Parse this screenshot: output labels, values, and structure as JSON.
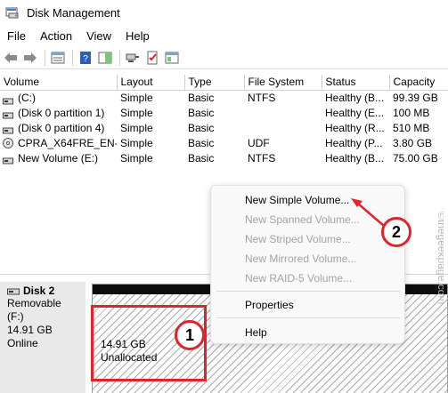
{
  "window": {
    "title": "Disk Management"
  },
  "menu": [
    "File",
    "Action",
    "View",
    "Help"
  ],
  "toolbar": {
    "buttons": [
      "back-arrow-icon",
      "forward-arrow-icon",
      "list-view-icon",
      "help-book-icon",
      "detail-pane-icon",
      "connect-icon",
      "checklist-icon",
      "properties-icon"
    ]
  },
  "table": {
    "headers": [
      "Volume",
      "Layout",
      "Type",
      "File System",
      "Status",
      "Capacity"
    ],
    "rows": [
      {
        "volume": "(C:)",
        "layout": "Simple",
        "type": "Basic",
        "fs": "NTFS",
        "status": "Healthy (B...",
        "capacity": "99.39 GB"
      },
      {
        "volume": "(Disk 0 partition 1)",
        "layout": "Simple",
        "type": "Basic",
        "fs": "",
        "status": "Healthy (E...",
        "capacity": "100 MB"
      },
      {
        "volume": "(Disk 0 partition 4)",
        "layout": "Simple",
        "type": "Basic",
        "fs": "",
        "status": "Healthy (R...",
        "capacity": "510 MB"
      },
      {
        "volume": "CPRA_X64FRE_EN-...",
        "layout": "Simple",
        "type": "Basic",
        "fs": "UDF",
        "status": "Healthy (P...",
        "capacity": "3.80 GB"
      },
      {
        "volume": "New Volume (E:)",
        "layout": "Simple",
        "type": "Basic",
        "fs": "NTFS",
        "status": "Healthy (B...",
        "capacity": "75.00 GB"
      }
    ]
  },
  "disk": {
    "name": "Disk 2",
    "type": "Removable (F:)",
    "size": "14.91 GB",
    "state": "Online",
    "partition": {
      "size": "14.91 GB",
      "label": "Unallocated"
    }
  },
  "context_menu": {
    "items": [
      {
        "label": "New Simple Volume...",
        "enabled": true
      },
      {
        "label": "New Spanned Volume...",
        "enabled": false
      },
      {
        "label": "New Striped Volume...",
        "enabled": false
      },
      {
        "label": "New Mirrored Volume...",
        "enabled": false
      },
      {
        "label": "New RAID-5 Volume...",
        "enabled": false
      },
      {
        "label": "Properties",
        "enabled": true
      },
      {
        "label": "Help",
        "enabled": true
      }
    ]
  },
  "annotations": {
    "step1": "1",
    "step2": "2"
  },
  "watermark": "©thegeekpage.com",
  "colors": {
    "annotation_red": "#e0242c",
    "disabled_text": "#a3a3a3"
  }
}
